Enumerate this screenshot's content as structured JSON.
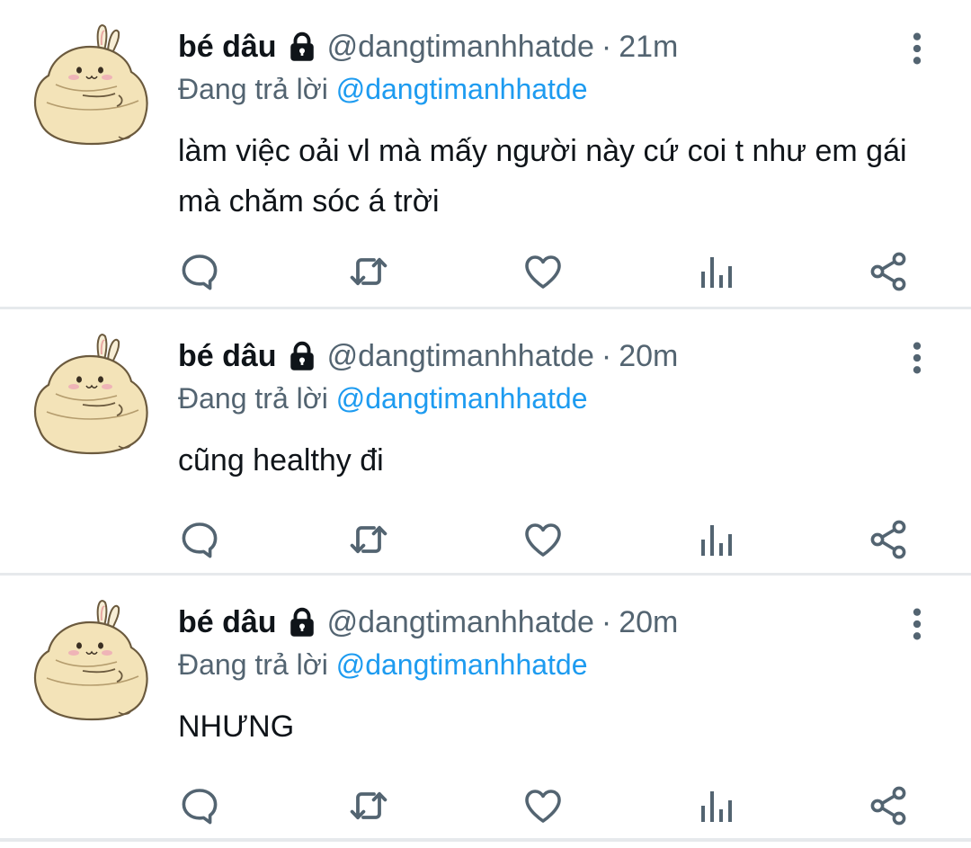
{
  "tweets": [
    {
      "name": "bé dâu",
      "handle": "@dangtimanhhatde",
      "separator": "·",
      "time": "21m",
      "reply_prefix": "Đang trả lời",
      "reply_handle": "@dangtimanhhatde",
      "text": "làm việc oải vl mà mấy người này cứ coi t như em gái mà chăm sóc á trời"
    },
    {
      "name": "bé dâu",
      "handle": "@dangtimanhhatde",
      "separator": "·",
      "time": "20m",
      "reply_prefix": "Đang trả lời",
      "reply_handle": "@dangtimanhhatde",
      "text": "cũng healthy đi"
    },
    {
      "name": "bé dâu",
      "handle": "@dangtimanhhatde",
      "separator": "·",
      "time": "20m",
      "reply_prefix": "Đang trả lời",
      "reply_handle": "@dangtimanhhatde",
      "text": "NHƯNG"
    }
  ],
  "icons": {
    "protected": "lock-icon",
    "more": "more-vertical-icon",
    "reply": "reply-icon",
    "retweet": "retweet-icon",
    "like": "heart-icon",
    "views": "views-icon",
    "share": "share-icon"
  },
  "colors": {
    "text": "#0f1419",
    "secondary": "#536471",
    "link": "#1d9bf0",
    "divider": "#e6e9ec",
    "icon": "#536471",
    "avatar_body": "#f3e3b8",
    "avatar_outline": "#6b5a3e"
  }
}
